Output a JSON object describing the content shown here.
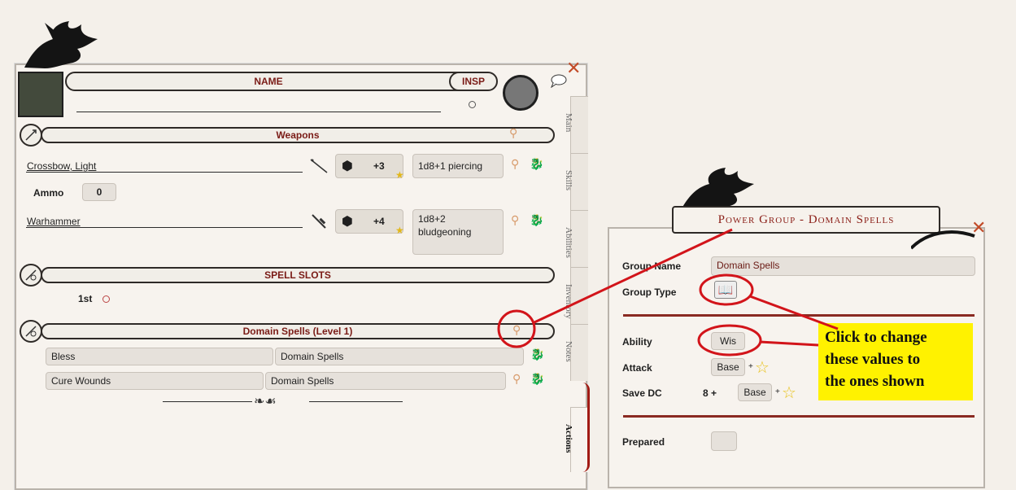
{
  "character": {
    "name_label": "NAME",
    "insp_label": "INSP"
  },
  "weapons": {
    "header": "Weapons",
    "items": [
      {
        "name": "Crossbow, Light",
        "bonus": "+3",
        "damage": "1d8+1 piercing"
      },
      {
        "name": "Warhammer",
        "bonus": "+4",
        "damage_line1": "1d8+2",
        "damage_line2": "bludgeoning"
      }
    ],
    "ammo_label": "Ammo",
    "ammo_value": "0"
  },
  "spell_slots": {
    "header": "SPELL SLOTS",
    "level_label": "1st"
  },
  "domain_spells": {
    "header": "Domain Spells (Level 1)",
    "rows": [
      {
        "spell": "Bless",
        "group": "Domain Spells"
      },
      {
        "spell": "Cure Wounds",
        "group": "Domain Spells"
      }
    ]
  },
  "tabs": [
    "Main",
    "Skills",
    "Abilities",
    "Inventory",
    "Notes",
    "Actions"
  ],
  "power_group": {
    "title": "Power Group - Domain Spells",
    "group_name_label": "Group Name",
    "group_name_value": "Domain Spells",
    "group_type_label": "Group Type",
    "ability_label": "Ability",
    "ability_value": "Wis",
    "attack_label": "Attack",
    "attack_value": "Base",
    "save_dc_label": "Save DC",
    "save_dc_prefix": "8 +",
    "save_dc_value": "Base",
    "plus": "+",
    "prepared_label": "Prepared"
  },
  "callout": {
    "line1": "Click to change",
    "line2": "these values to",
    "line3": "the ones shown"
  },
  "icons": {
    "dice": "d20-icon",
    "star": "star-icon",
    "pin": "pin-icon",
    "dragon": "dragon-icon",
    "book": "book-icon"
  },
  "colors": {
    "accent_red": "#a11a14",
    "highlight_circle": "#d2141a",
    "callout_bg": "#fff200"
  }
}
